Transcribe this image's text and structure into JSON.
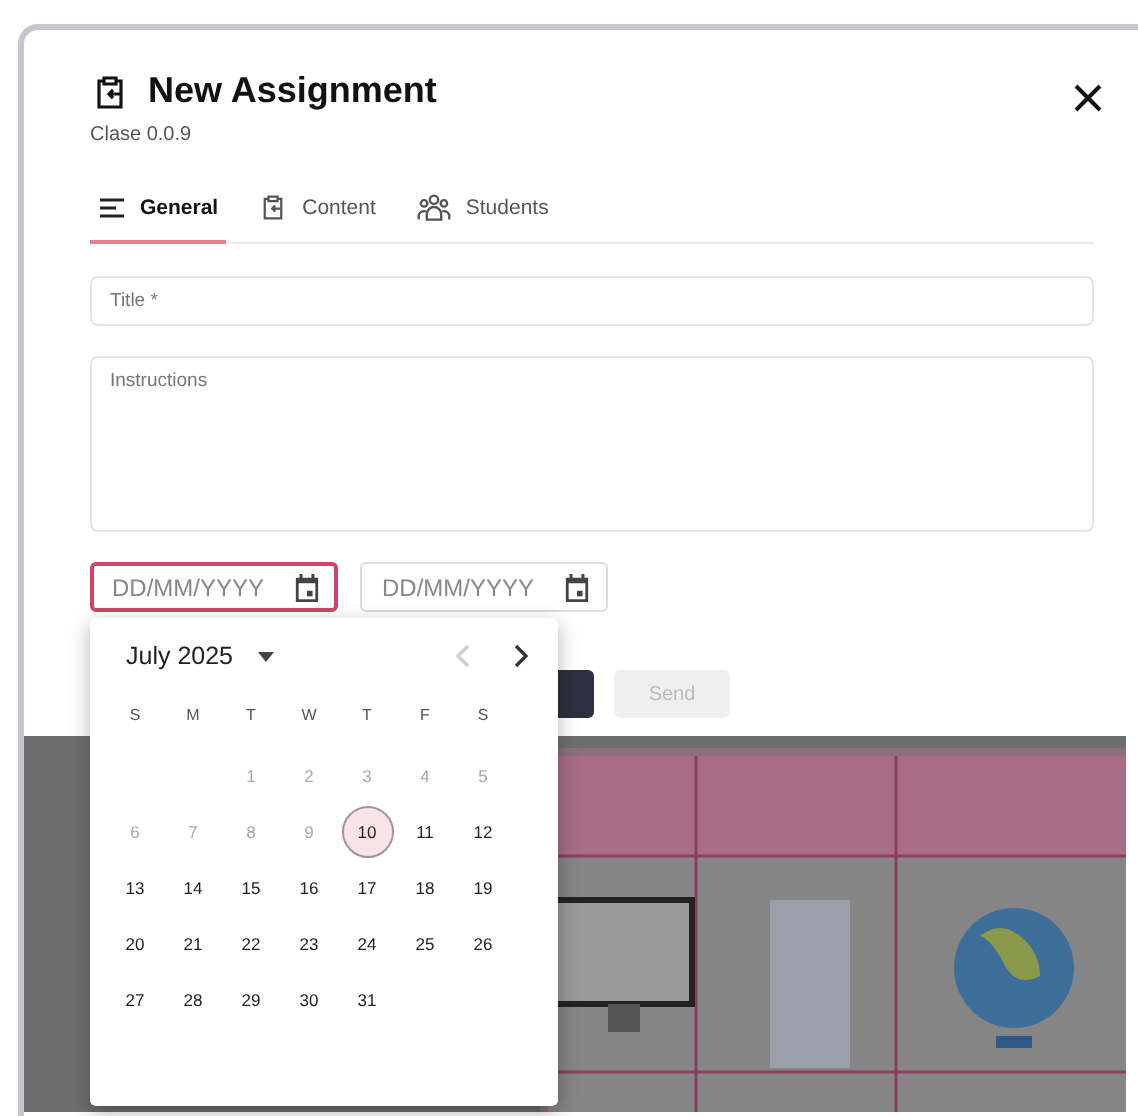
{
  "dialog": {
    "title": "New Assignment",
    "subtitle": "Clase 0.0.9"
  },
  "tabs": [
    {
      "label": "General",
      "selected": true
    },
    {
      "label": "Content",
      "selected": false
    },
    {
      "label": "Students",
      "selected": false
    }
  ],
  "form": {
    "title_field": {
      "placeholder": "Title *"
    },
    "instructions_field": {
      "placeholder": "Instructions"
    },
    "date_fields": [
      {
        "placeholder": "DD/MM/YYYY",
        "focused": true
      },
      {
        "placeholder": "DD/MM/YYYY",
        "focused": false
      }
    ]
  },
  "buttons": [
    {
      "kind": "primary"
    },
    {
      "kind": "secondary",
      "label": "Send",
      "disabled": true
    }
  ],
  "calendar": {
    "month": "July 2025",
    "prev_disabled": true,
    "next_disabled": false,
    "weekdays": [
      "S",
      "M",
      "T",
      "W",
      "T",
      "F",
      "S"
    ],
    "weeks": [
      [
        {
          "kind": "blank"
        },
        {
          "kind": "blank"
        },
        {
          "kind": "day",
          "label": "1",
          "disabled": true,
          "selected": false
        },
        {
          "kind": "day",
          "label": "2",
          "disabled": true,
          "selected": false
        },
        {
          "kind": "day",
          "label": "3",
          "disabled": true,
          "selected": false
        },
        {
          "kind": "day",
          "label": "4",
          "disabled": true,
          "selected": false
        },
        {
          "kind": "day",
          "label": "5",
          "disabled": true,
          "selected": false
        }
      ],
      [
        {
          "kind": "day",
          "label": "6",
          "disabled": true,
          "selected": false
        },
        {
          "kind": "day",
          "label": "7",
          "disabled": true,
          "selected": false
        },
        {
          "kind": "day",
          "label": "8",
          "disabled": true,
          "selected": false
        },
        {
          "kind": "day",
          "label": "9",
          "disabled": true,
          "selected": false
        },
        {
          "kind": "day",
          "label": "10",
          "disabled": false,
          "selected": true
        },
        {
          "kind": "day",
          "label": "11",
          "disabled": false,
          "selected": false
        },
        {
          "kind": "day",
          "label": "12",
          "disabled": false,
          "selected": false
        }
      ],
      [
        {
          "kind": "day",
          "label": "13",
          "disabled": false,
          "selected": false
        },
        {
          "kind": "day",
          "label": "14",
          "disabled": false,
          "selected": false
        },
        {
          "kind": "day",
          "label": "15",
          "disabled": false,
          "selected": false
        },
        {
          "kind": "day",
          "label": "16",
          "disabled": false,
          "selected": false
        },
        {
          "kind": "day",
          "label": "17",
          "disabled": false,
          "selected": false
        },
        {
          "kind": "day",
          "label": "18",
          "disabled": false,
          "selected": false
        },
        {
          "kind": "day",
          "label": "19",
          "disabled": false,
          "selected": false
        }
      ],
      [
        {
          "kind": "day",
          "label": "20",
          "disabled": false,
          "selected": false
        },
        {
          "kind": "day",
          "label": "21",
          "disabled": false,
          "selected": false
        },
        {
          "kind": "day",
          "label": "22",
          "disabled": false,
          "selected": false
        },
        {
          "kind": "day",
          "label": "23",
          "disabled": false,
          "selected": false
        },
        {
          "kind": "day",
          "label": "24",
          "disabled": false,
          "selected": false
        },
        {
          "kind": "day",
          "label": "25",
          "disabled": false,
          "selected": false
        },
        {
          "kind": "day",
          "label": "26",
          "disabled": false,
          "selected": false
        }
      ],
      [
        {
          "kind": "day",
          "label": "27",
          "disabled": false,
          "selected": false
        },
        {
          "kind": "day",
          "label": "28",
          "disabled": false,
          "selected": false
        },
        {
          "kind": "day",
          "label": "29",
          "disabled": false,
          "selected": false
        },
        {
          "kind": "day",
          "label": "30",
          "disabled": false,
          "selected": false
        },
        {
          "kind": "day",
          "label": "31",
          "disabled": false,
          "selected": false
        }
      ]
    ]
  }
}
